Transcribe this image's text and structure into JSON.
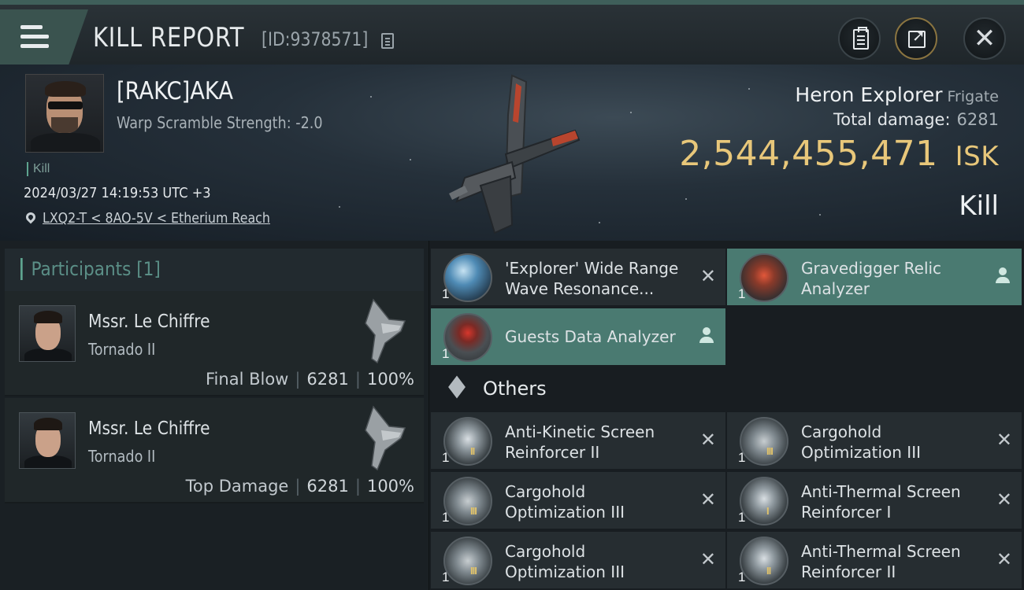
{
  "header": {
    "title": "KILL REPORT",
    "report_id": "[ID:9378571]"
  },
  "victim": {
    "name": "[RAKC]AKA",
    "warp_scramble": "Warp Scramble Strength: -2.0",
    "tag": "Kill",
    "datetime": "2024/03/27 14:19:53 UTC +3",
    "location": "LXQ2-T < 8AO-5V < Etherium Reach",
    "ship_name": "Heron Explorer",
    "ship_class": "Frigate",
    "total_damage_label": "Total damage:",
    "total_damage_value": "6281",
    "isk_value": "2,544,455,471",
    "isk_unit": "ISK",
    "result": "Kill"
  },
  "participants": {
    "header": "Participants [1]",
    "items": [
      {
        "name": "Mssr. Le Chiffre",
        "ship": "Tornado II",
        "role": "Final Blow",
        "damage": "6281",
        "percent": "100%"
      },
      {
        "name": "Mssr. Le Chiffre",
        "ship": "Tornado II",
        "role": "Top Damage",
        "damage": "6281",
        "percent": "100%"
      }
    ]
  },
  "fitted_items": [
    {
      "name": "'Explorer' Wide Range Wave Resonance...",
      "qty": "1",
      "icon": "scanner-probe-icon",
      "state": "destroyed"
    },
    {
      "name": "Gravedigger Relic Analyzer",
      "qty": "1",
      "icon": "relic-analyzer-icon",
      "state": "dropped"
    },
    {
      "name": "Guests Data Analyzer",
      "qty": "1",
      "icon": "data-analyzer-icon",
      "state": "dropped"
    }
  ],
  "others": {
    "label": "Others",
    "items": [
      {
        "name": "Anti-Kinetic Screen Reinforcer II",
        "qty": "1",
        "tier": "II",
        "icon": "shield-rig-icon"
      },
      {
        "name": "Cargohold Optimization III",
        "qty": "1",
        "tier": "III",
        "icon": "cargo-rig-icon"
      },
      {
        "name": "Cargohold Optimization III",
        "qty": "1",
        "tier": "III",
        "icon": "cargo-rig-icon"
      },
      {
        "name": "Anti-Thermal Screen Reinforcer I",
        "qty": "1",
        "tier": "I",
        "icon": "shield-rig-icon"
      },
      {
        "name": "Cargohold Optimization III",
        "qty": "1",
        "tier": "III",
        "icon": "cargo-rig-icon"
      },
      {
        "name": "Anti-Thermal Screen Reinforcer II",
        "qty": "1",
        "tier": "II",
        "icon": "shield-rig-icon"
      }
    ]
  },
  "colors": {
    "accent": "#5ea48f",
    "highlight_row": "#4a7a71",
    "isk_gold": "#e8c77a"
  }
}
